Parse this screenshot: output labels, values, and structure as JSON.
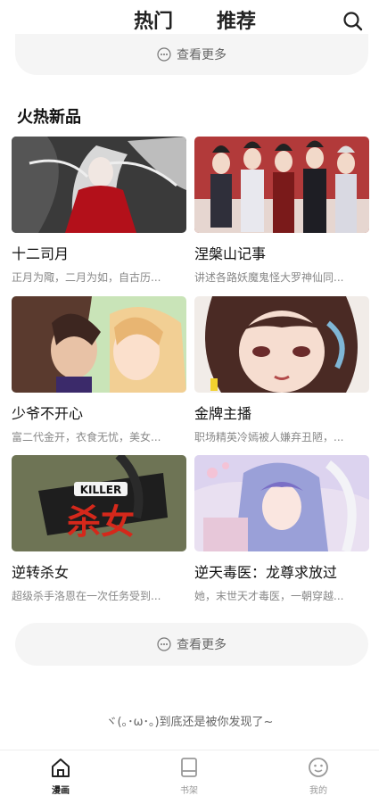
{
  "header": {
    "tabs": [
      {
        "label": "热门",
        "active": false
      },
      {
        "label": "推荐",
        "active": true
      }
    ],
    "search_icon": "search-icon"
  },
  "more_label": "查看更多",
  "section": {
    "title": "火热新品",
    "items": [
      {
        "title": "十二司月",
        "desc": "正月为陬，二月为如，自古历..."
      },
      {
        "title": "涅槃山记事",
        "desc": "讲述各路妖魔鬼怪大罗神仙同..."
      },
      {
        "title": "少爷不开心",
        "desc": "富二代金开，衣食无忧，美女..."
      },
      {
        "title": "金牌主播",
        "desc": "职场精英冷嫣被人嫌弃丑陋，..."
      },
      {
        "title": "逆转杀女",
        "desc": "超级杀手洛恩在一次任务受到..."
      },
      {
        "title": "逆天毒医：龙尊求放过",
        "desc": "她，末世天才毒医，一朝穿越..."
      }
    ]
  },
  "cover_art_text": {
    "killer_badge": "KILLER",
    "killer_title": "杀女"
  },
  "footer_note": "ヾ(｡･ω･｡)到底还是被你发现了~",
  "bottom_nav": [
    {
      "label": "漫画",
      "icon": "home-icon",
      "active": true
    },
    {
      "label": "书架",
      "icon": "bookshelf-icon",
      "active": false
    },
    {
      "label": "我的",
      "icon": "profile-icon",
      "active": false
    }
  ],
  "colors": {
    "accent": "#222222",
    "pill_bg": "#f5f5f5",
    "muted_text": "#888888"
  }
}
